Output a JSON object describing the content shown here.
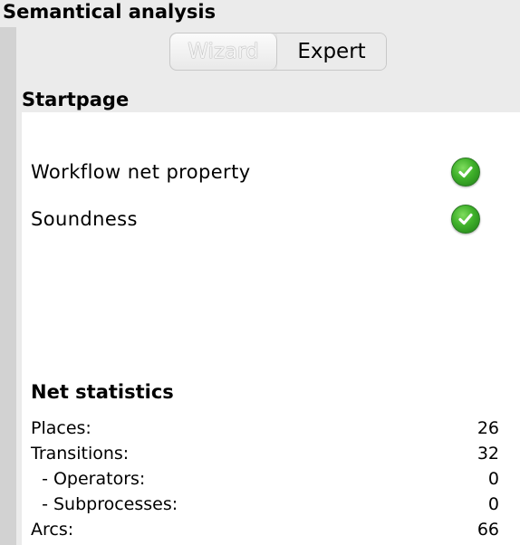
{
  "header": {
    "title": "Semantical analysis"
  },
  "tabs": [
    {
      "label": "Wizard",
      "state": "disabled"
    },
    {
      "label": "Expert",
      "state": "normal"
    }
  ],
  "startpage": {
    "title": "Startpage",
    "properties": [
      {
        "label": "Workflow net property",
        "icon": "green-checkmark-icon",
        "status": "ok"
      },
      {
        "label": "Soundness",
        "icon": "green-checkmark-icon",
        "status": "ok"
      }
    ]
  },
  "net_statistics": {
    "title": "Net statistics",
    "rows": [
      {
        "label": "Places:",
        "value": "26"
      },
      {
        "label": "Transitions:",
        "value": "32"
      },
      {
        "label": "  - Operators:",
        "value": "0"
      },
      {
        "label": "  - Subprocesses:",
        "value": "0"
      },
      {
        "label": "Arcs:",
        "value": "66"
      }
    ]
  },
  "colors": {
    "background": "#ebebeb",
    "content_background": "#ffffff",
    "check_green": "#3fb02a"
  }
}
